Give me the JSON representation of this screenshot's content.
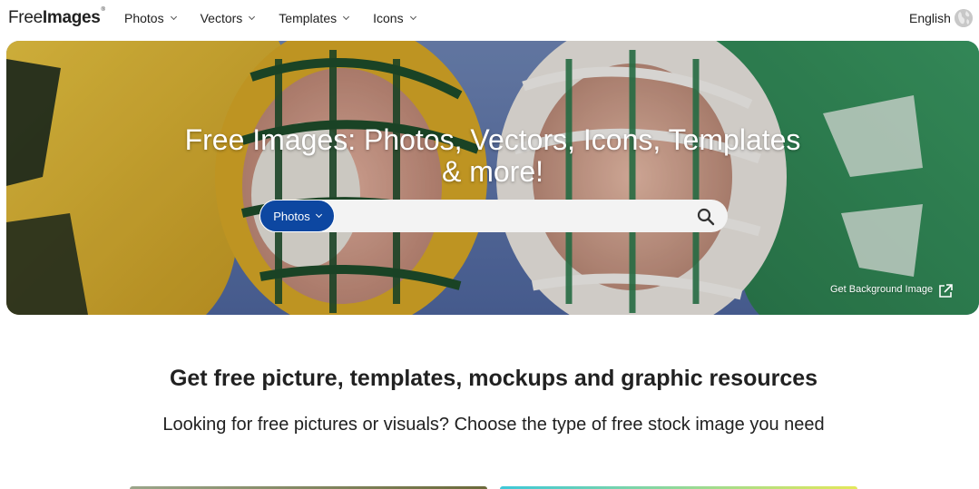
{
  "header": {
    "logo": {
      "part1": "Free",
      "part2": "Images",
      "mark": "®"
    },
    "nav": [
      {
        "label": "Photos"
      },
      {
        "label": "Vectors"
      },
      {
        "label": "Templates"
      },
      {
        "label": "Icons"
      }
    ],
    "language": "English",
    "globe_icon": "globe-icon"
  },
  "hero": {
    "title_line1": "Free Images: Photos, Vectors, Icons, Templates",
    "title_line2": "& more!",
    "search": {
      "type_label": "Photos",
      "placeholder": "",
      "icon": "search-icon"
    },
    "background_link": "Get Background Image",
    "external_icon": "external-link-icon"
  },
  "content": {
    "headline": "Get free picture, templates, mockups and graphic resources",
    "subline": "Looking for free pictures or visuals? Choose the type of free stock image you need"
  },
  "colors": {
    "accent": "#0d47a1",
    "text": "#212121",
    "search_bg": "#f3f3f3"
  }
}
